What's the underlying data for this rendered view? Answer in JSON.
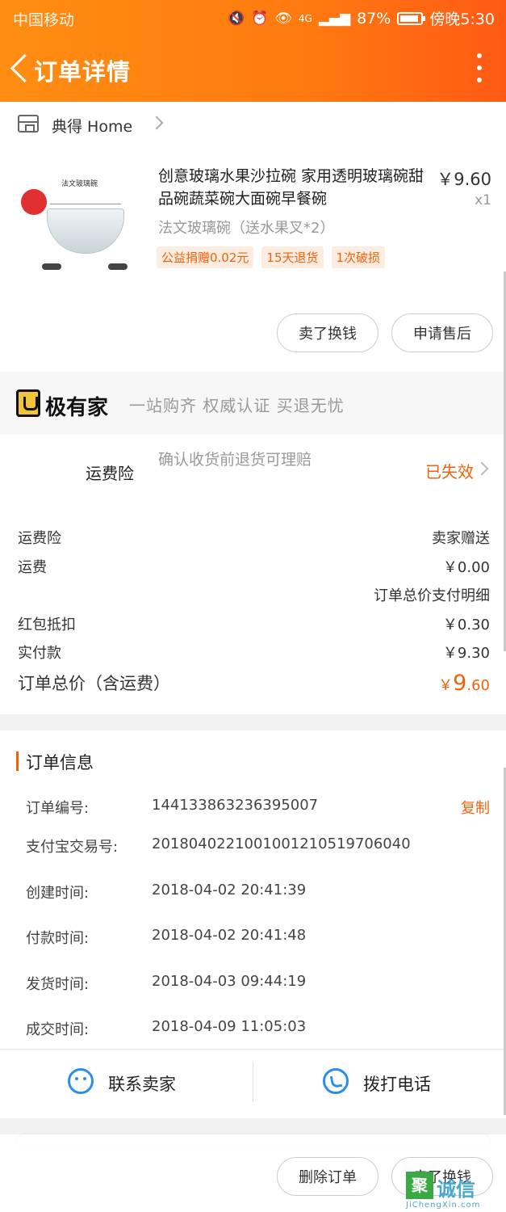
{
  "status_bar": {
    "carrier": "中国移动",
    "battery": "87%",
    "time": "傍晚5:30",
    "network": "4G"
  },
  "nav": {
    "title": "订单详情"
  },
  "shop": {
    "name": "典得 Home"
  },
  "product": {
    "thumb_label": "法文玻璃碗",
    "title": "创意玻璃水果沙拉碗 家用透明玻璃碗甜品碗蔬菜碗大面碗早餐碗",
    "price": "￥9.60",
    "qty": "x1",
    "spec": "法文玻璃碗（送水果叉*2）",
    "tags": [
      "公益捐赠0.02元",
      "15天退货",
      "1次破损"
    ]
  },
  "actions": {
    "sell_exchange": "卖了换钱",
    "after_sale": "申请售后"
  },
  "jiyoujia": {
    "name": "极有家",
    "slogan": "一站购齐 权威认证 买退无忧"
  },
  "insurance": {
    "label": "运费险",
    "desc": "确认收货前退货可理赔",
    "status": "已失效"
  },
  "fees": {
    "insurance_label": "运费险",
    "insurance_value": "卖家赠送",
    "shipping_label": "运费",
    "shipping_value": "￥0.00",
    "payment_detail": "订单总价支付明细",
    "redpack_label": "红包抵扣",
    "redpack_value": "￥0.30",
    "paid_label": "实付款",
    "paid_value": "￥9.30",
    "total_label": "订单总价（含运费）",
    "total_symbol": "￥",
    "total_int": "9",
    "total_dec": ".60"
  },
  "order_info": {
    "title": "订单信息",
    "copy": "复制",
    "rows": [
      {
        "key": "订单编号:",
        "value": "144133863236395007"
      },
      {
        "key": "支付宝交易号:",
        "value": "2018040221001001210519706040"
      },
      {
        "key": "创建时间:",
        "value": "2018-04-02 20:41:39"
      },
      {
        "key": "付款时间:",
        "value": "2018-04-02 20:41:48"
      },
      {
        "key": "发货时间:",
        "value": "2018-04-03 09:44:19"
      },
      {
        "key": "成交时间:",
        "value": "2018-04-09 11:05:03"
      }
    ],
    "contact_seller": "联系卖家",
    "call_phone": "拨打电话"
  },
  "bottom_bar": {
    "delete": "删除订单",
    "sell_exchange": "卖了换钱"
  },
  "watermark": {
    "box": "聚",
    "name": "诚信",
    "url": "JiChengXin.com"
  },
  "colors": {
    "accent": "#f0620a",
    "header_from": "#ff8d12",
    "header_to": "#ff5a14",
    "link_blue": "#2a8ef0"
  }
}
